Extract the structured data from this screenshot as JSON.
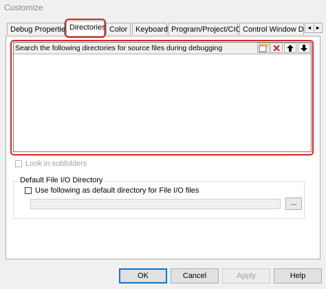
{
  "window": {
    "title": "Customize"
  },
  "tabs": [
    {
      "label": "Debug Properties",
      "active": false
    },
    {
      "label": "Directories",
      "active": true
    },
    {
      "label": "Color",
      "active": false
    },
    {
      "label": "Keyboard",
      "active": false
    },
    {
      "label": "Program/Project/CIO",
      "active": false
    },
    {
      "label": "Control Window Di",
      "active": false
    }
  ],
  "tab_scroll": {
    "left": "◄",
    "right": "►"
  },
  "directories": {
    "header": "Search the following directories for source files during debugging",
    "items": [],
    "toolbar": {
      "new_icon": "new-folder-icon",
      "delete_icon": "delete-icon",
      "up_icon": "move-up-icon",
      "down_icon": "move-down-icon"
    },
    "look_in_subfolders": {
      "label": "Look in subfolders",
      "checked": false,
      "enabled": false
    }
  },
  "file_io": {
    "group_label": "Default File I/O Directory",
    "use_default": {
      "label": "Use following as default directory for File I/O files",
      "checked": false
    },
    "path_value": "",
    "browse_label": "..."
  },
  "buttons": {
    "ok": "OK",
    "cancel": "Cancel",
    "apply": "Apply",
    "help": "Help"
  },
  "colors": {
    "highlight": "#e02020",
    "disabled_text": "#a0a0a0"
  }
}
